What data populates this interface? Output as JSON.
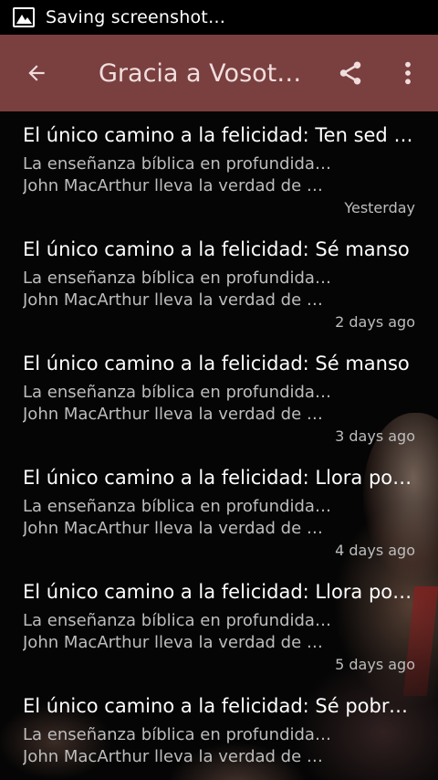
{
  "status_bar": {
    "icon": "image-icon",
    "text": "Saving screenshot…"
  },
  "app_bar": {
    "title": "Gracia a Vosotros",
    "back_icon": "arrow-back-icon",
    "share_icon": "share-icon",
    "more_icon": "more-vertical-icon",
    "color": "#7a3f3f"
  },
  "episodes": [
    {
      "title": "El único camino a la felicidad: Ten sed de justicia",
      "desc_line1": "La enseñanza bíblica en profundidad de",
      "desc_line2": "John MacArthur lleva la verdad de Dios a",
      "time": "Yesterday"
    },
    {
      "title": "El único camino a la felicidad: Sé manso",
      "desc_line1": "La enseñanza bíblica en profundidad de",
      "desc_line2": "John MacArthur lleva la verdad de Dios a",
      "time": "2 days ago"
    },
    {
      "title": "El único camino a la felicidad: Sé manso",
      "desc_line1": "La enseñanza bíblica en profundidad de",
      "desc_line2": "John MacArthur lleva la verdad de Dios a",
      "time": "3 days ago"
    },
    {
      "title": "El único camino a la felicidad: Llora por tu pecado",
      "desc_line1": "La enseñanza bíblica en profundidad de",
      "desc_line2": "John MacArthur lleva la verdad de Dios a",
      "time": "4 days ago"
    },
    {
      "title": "El único camino a la felicidad: Llora por tu pecado",
      "desc_line1": "La enseñanza bíblica en profundidad de",
      "desc_line2": "John MacArthur lleva la verdad de Dios a",
      "time": "5 days ago"
    },
    {
      "title": "El único camino a la felicidad: Sé pobre en espíritu",
      "desc_line1": "La enseñanza bíblica en profundidad de",
      "desc_line2": "John MacArthur lleva la verdad de Dios a",
      "time": ""
    }
  ]
}
